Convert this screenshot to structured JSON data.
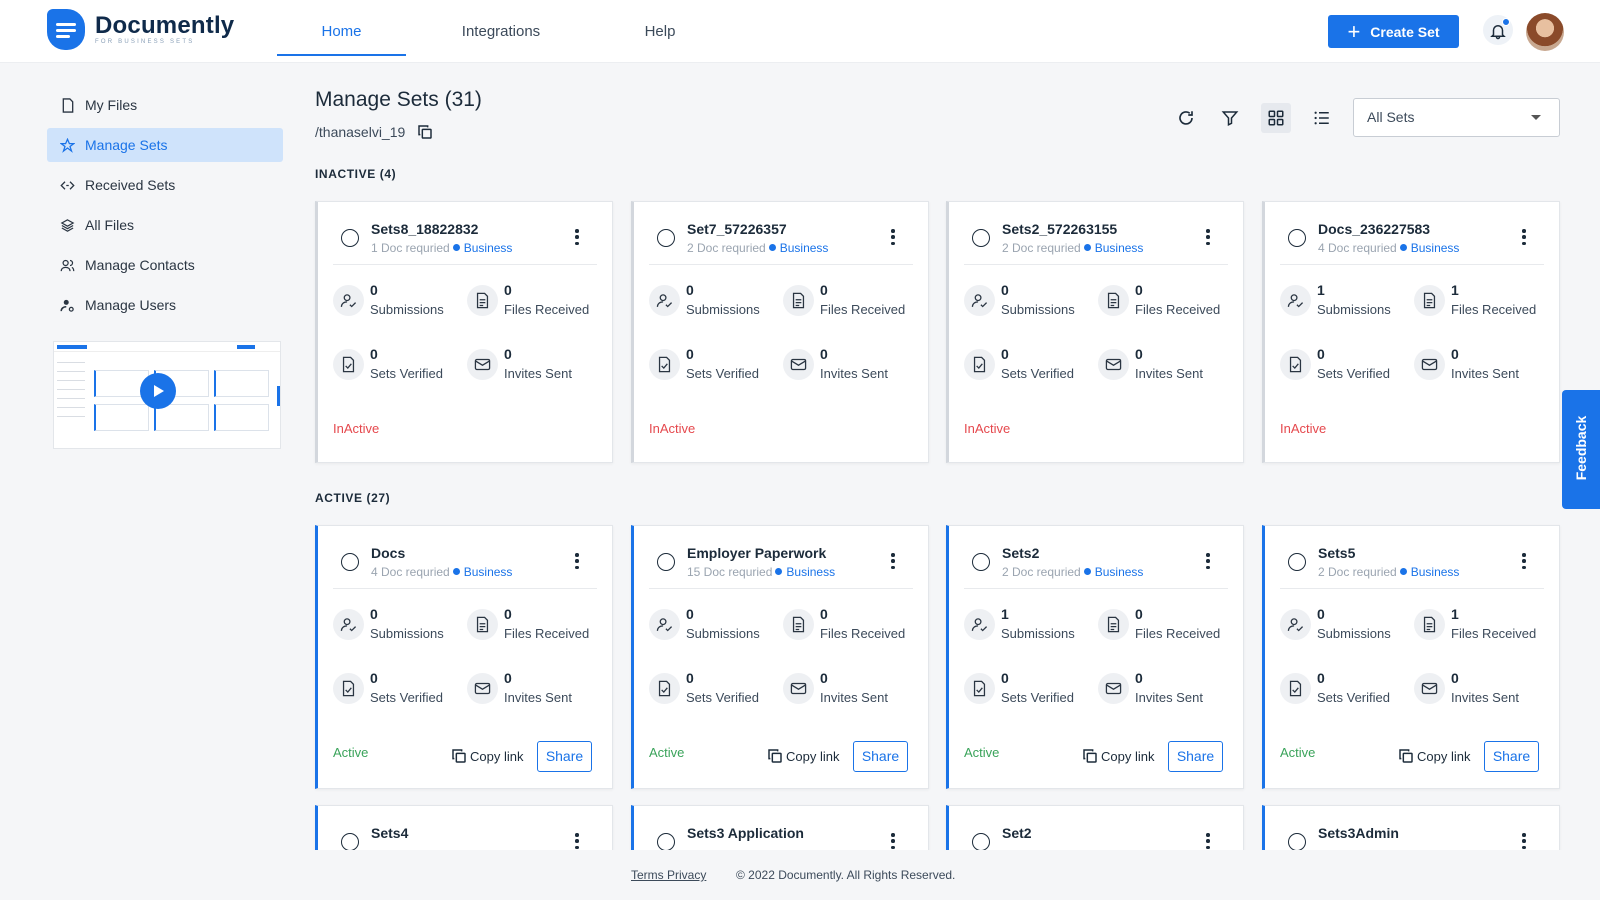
{
  "brand": {
    "name": "Documently",
    "tagline": "FOR BUSINESS SETS"
  },
  "nav": [
    {
      "label": "Home",
      "key": "home"
    },
    {
      "label": "Integrations",
      "key": "integrations"
    },
    {
      "label": "Help",
      "key": "help"
    }
  ],
  "header": {
    "create_label": "Create Set",
    "accent": "#1a73e8"
  },
  "sidebar": {
    "items": [
      {
        "label": "My Files",
        "icon": "file-icon"
      },
      {
        "label": "Manage Sets",
        "icon": "star-icon",
        "active": true
      },
      {
        "label": "Received Sets",
        "icon": "transfer-icon"
      },
      {
        "label": "All Files",
        "icon": "layers-icon"
      },
      {
        "label": "Manage Contacts",
        "icon": "contacts-icon"
      },
      {
        "label": "Manage Users",
        "icon": "user-settings-icon"
      }
    ]
  },
  "main": {
    "title": "Manage Sets (31)",
    "path": "/thanaselvi_19",
    "filter_value": "All Sets"
  },
  "sections": [
    {
      "label": "INACTIVE (4)",
      "cards": [
        {
          "name": "Sets8_18822832",
          "docs": "1 Doc requried",
          "tag": "Business",
          "submissions": "0",
          "files_received": "0",
          "sets_verified": "0",
          "invites_sent": "0",
          "status": "InActive"
        },
        {
          "name": "Set7_57226357",
          "docs": "2 Doc requried",
          "tag": "Business",
          "submissions": "0",
          "files_received": "0",
          "sets_verified": "0",
          "invites_sent": "0",
          "status": "InActive"
        },
        {
          "name": "Sets2_572263155",
          "docs": "2 Doc requried",
          "tag": "Business",
          "submissions": "0",
          "files_received": "0",
          "sets_verified": "0",
          "invites_sent": "0",
          "status": "InActive"
        },
        {
          "name": "Docs_236227583",
          "docs": "4 Doc requried",
          "tag": "Business",
          "submissions": "1",
          "files_received": "1",
          "sets_verified": "0",
          "invites_sent": "0",
          "status": "InActive"
        }
      ]
    },
    {
      "label": "ACTIVE (27)",
      "cards": [
        {
          "name": "Docs",
          "docs": "4 Doc requried",
          "tag": "Business",
          "submissions": "0",
          "files_received": "0",
          "sets_verified": "0",
          "invites_sent": "0",
          "status": "Active"
        },
        {
          "name": "Employer Paperwork",
          "docs": "15 Doc requried",
          "tag": "Business",
          "submissions": "0",
          "files_received": "0",
          "sets_verified": "0",
          "invites_sent": "0",
          "status": "Active"
        },
        {
          "name": "Sets2",
          "docs": "2 Doc requried",
          "tag": "Business",
          "submissions": "1",
          "files_received": "0",
          "sets_verified": "0",
          "invites_sent": "0",
          "status": "Active"
        },
        {
          "name": "Sets5",
          "docs": "2 Doc requried",
          "tag": "Business",
          "submissions": "0",
          "files_received": "1",
          "sets_verified": "0",
          "invites_sent": "0",
          "status": "Active"
        },
        {
          "name": "Sets4",
          "docs": "",
          "tag": "",
          "submissions": "",
          "files_received": "",
          "sets_verified": "",
          "invites_sent": "",
          "status": ""
        },
        {
          "name": "Sets3 Application",
          "docs": "",
          "tag": "",
          "submissions": "",
          "files_received": "",
          "sets_verified": "",
          "invites_sent": "",
          "status": ""
        },
        {
          "name": "Set2",
          "docs": "",
          "tag": "",
          "submissions": "",
          "files_received": "",
          "sets_verified": "",
          "invites_sent": "",
          "status": ""
        },
        {
          "name": "Sets3Admin",
          "docs": "",
          "tag": "",
          "submissions": "",
          "files_received": "",
          "sets_verified": "",
          "invites_sent": "",
          "status": ""
        }
      ]
    }
  ],
  "labels": {
    "submissions": "Submissions",
    "files_received": "Files Received",
    "sets_verified": "Sets Verified",
    "invites_sent": "Invites Sent",
    "copy_link": "Copy link",
    "share": "Share"
  },
  "feedback_label": "Feedback",
  "footer": {
    "links": "Terms Privacy",
    "copyright": "© 2022 Documently. All Rights Reserved."
  }
}
